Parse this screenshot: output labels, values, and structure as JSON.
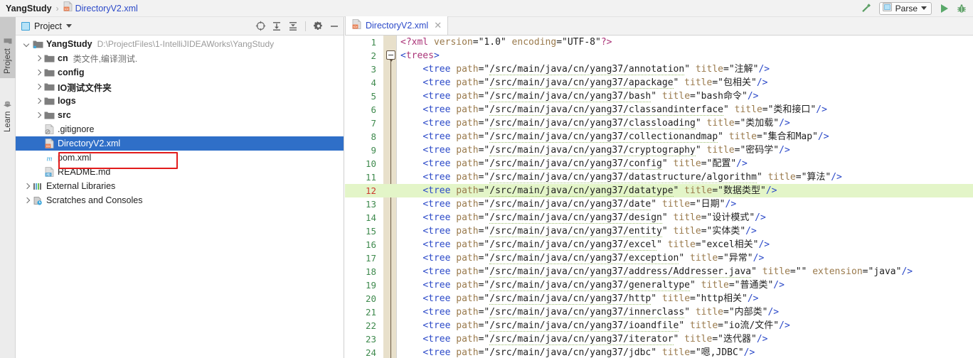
{
  "breadcrumb": {
    "project": "YangStudy",
    "separator": "›",
    "file": "DirectoryV2.xml",
    "file_icon": "xml-file-icon"
  },
  "topbar": {
    "hammer_icon": "build-hammer-icon",
    "run_config_label": "Parse",
    "run_config_icon": "run-configuration-icon",
    "caret_icon": "chevron-down-icon",
    "run_icon": "run-play-icon",
    "debug_icon": "debug-bug-icon",
    "accent_green": "#59a869",
    "accent_blue": "#2b49c8"
  },
  "toolstrip": {
    "items": [
      {
        "label": "Project",
        "icon": "folder-icon",
        "active": true
      },
      {
        "label": "Learn",
        "icon": "graduation-cap-icon",
        "active": false
      }
    ]
  },
  "project_panel": {
    "tab_label": "Project",
    "tab_icon": "project-view-icon",
    "caret_icon": "chevron-down-icon",
    "tools": [
      {
        "name": "select-opened-file-icon",
        "glyph": "⊕"
      },
      {
        "name": "expand-all-icon",
        "glyph": "⤓"
      },
      {
        "name": "collapse-all-icon",
        "glyph": "⤒"
      },
      {
        "name": "settings-gear-icon",
        "glyph": "⚙"
      },
      {
        "name": "hide-panel-icon",
        "glyph": "—"
      }
    ],
    "tree": [
      {
        "indent": 0,
        "arrow": "expanded",
        "icon": "module-folder-icon",
        "label": "YangStudy",
        "bold": true,
        "path": "D:\\ProjectFiles\\1-IntelliJIDEAWorks\\YangStudy",
        "note": "",
        "selected": false
      },
      {
        "indent": 1,
        "arrow": "collapsed",
        "icon": "folder-icon",
        "label": "cn",
        "bold": true,
        "path": "",
        "note": "类文件,编译测试.",
        "selected": false
      },
      {
        "indent": 1,
        "arrow": "collapsed",
        "icon": "folder-icon",
        "label": "config",
        "bold": true,
        "path": "",
        "note": "",
        "selected": false
      },
      {
        "indent": 1,
        "arrow": "collapsed",
        "icon": "folder-icon",
        "label": "IO测试文件夹",
        "bold": true,
        "path": "",
        "note": "",
        "selected": false
      },
      {
        "indent": 1,
        "arrow": "collapsed",
        "icon": "folder-icon",
        "label": "logs",
        "bold": true,
        "path": "",
        "note": "",
        "selected": false
      },
      {
        "indent": 1,
        "arrow": "collapsed",
        "icon": "folder-icon",
        "label": "src",
        "bold": true,
        "path": "",
        "note": "",
        "selected": false
      },
      {
        "indent": 1,
        "arrow": "none",
        "icon": "gitignore-file-icon",
        "label": ".gitignore",
        "bold": false,
        "path": "",
        "note": "",
        "selected": false
      },
      {
        "indent": 1,
        "arrow": "none",
        "icon": "xml-file-icon",
        "label": "DirectoryV2.xml",
        "bold": false,
        "path": "",
        "note": "",
        "selected": true
      },
      {
        "indent": 1,
        "arrow": "none",
        "icon": "maven-file-icon",
        "label": "pom.xml",
        "bold": false,
        "path": "",
        "note": "",
        "selected": false
      },
      {
        "indent": 1,
        "arrow": "none",
        "icon": "markdown-file-icon",
        "label": "README.md",
        "bold": false,
        "path": "",
        "note": "",
        "selected": false
      },
      {
        "indent": 0,
        "arrow": "collapsed",
        "icon": "external-libraries-icon",
        "label": "External Libraries",
        "bold": false,
        "path": "",
        "note": "",
        "selected": false
      },
      {
        "indent": 0,
        "arrow": "collapsed",
        "icon": "scratches-icon",
        "label": "Scratches and Consoles",
        "bold": false,
        "path": "",
        "note": "",
        "selected": false
      }
    ],
    "annotation_box_color": "#e21b1b"
  },
  "editor": {
    "tab": {
      "label": "DirectoryV2.xml",
      "icon": "xml-file-icon",
      "close_icon": "close-icon"
    },
    "highlighted_line": 12,
    "highlight_color": "#e3f5c8",
    "fold_marker_line": 2,
    "lines": [
      {
        "n": 1,
        "type": "pi",
        "text": "<?xml version=\"1.0\" encoding=\"UTF-8\"?>"
      },
      {
        "n": 2,
        "type": "root",
        "text": "<trees>"
      },
      {
        "n": 3,
        "type": "tree",
        "path": "/src/main/java/cn/yang37/annotation",
        "title": "注解",
        "extension": ""
      },
      {
        "n": 4,
        "type": "tree",
        "path": "/src/main/java/cn/yang37/apackage",
        "title": "包相关",
        "extension": ""
      },
      {
        "n": 5,
        "type": "tree",
        "path": "/src/main/java/cn/yang37/bash",
        "title": "bash命令",
        "extension": ""
      },
      {
        "n": 6,
        "type": "tree",
        "path": "/src/main/java/cn/yang37/classandinterface",
        "title": "类和接口",
        "extension": ""
      },
      {
        "n": 7,
        "type": "tree",
        "path": "/src/main/java/cn/yang37/classloading",
        "title": "类加载",
        "extension": ""
      },
      {
        "n": 8,
        "type": "tree",
        "path": "/src/main/java/cn/yang37/collectionandmap",
        "title": "集合和Map",
        "extension": ""
      },
      {
        "n": 9,
        "type": "tree",
        "path": "/src/main/java/cn/yang37/cryptography",
        "title": "密码学",
        "extension": ""
      },
      {
        "n": 10,
        "type": "tree",
        "path": "/src/main/java/cn/yang37/config",
        "title": "配置",
        "extension": ""
      },
      {
        "n": 11,
        "type": "tree",
        "path": "/src/main/java/cn/yang37/datastructure/algorithm",
        "title": "算法",
        "extension": ""
      },
      {
        "n": 12,
        "type": "tree",
        "path": "/src/main/java/cn/yang37/datatype",
        "title": "数据类型",
        "extension": ""
      },
      {
        "n": 13,
        "type": "tree",
        "path": "/src/main/java/cn/yang37/date",
        "title": "日期",
        "extension": ""
      },
      {
        "n": 14,
        "type": "tree",
        "path": "/src/main/java/cn/yang37/design",
        "title": "设计模式",
        "extension": ""
      },
      {
        "n": 15,
        "type": "tree",
        "path": "/src/main/java/cn/yang37/entity",
        "title": "实体类",
        "extension": ""
      },
      {
        "n": 16,
        "type": "tree",
        "path": "/src/main/java/cn/yang37/excel",
        "title": "excel相关",
        "extension": ""
      },
      {
        "n": 17,
        "type": "tree",
        "path": "/src/main/java/cn/yang37/exception",
        "title": "异常",
        "extension": ""
      },
      {
        "n": 18,
        "type": "tree",
        "path": "/src/main/java/cn/yang37/address/Addresser.java",
        "title": "",
        "extension": "java"
      },
      {
        "n": 19,
        "type": "tree",
        "path": "/src/main/java/cn/yang37/generaltype",
        "title": "普通类",
        "extension": ""
      },
      {
        "n": 20,
        "type": "tree",
        "path": "/src/main/java/cn/yang37/http",
        "title": "http相关",
        "extension": ""
      },
      {
        "n": 21,
        "type": "tree",
        "path": "/src/main/java/cn/yang37/innerclass",
        "title": "内部类",
        "extension": ""
      },
      {
        "n": 22,
        "type": "tree",
        "path": "/src/main/java/cn/yang37/ioandfile",
        "title": "io流/文件",
        "extension": ""
      },
      {
        "n": 23,
        "type": "tree",
        "path": "/src/main/java/cn/yang37/iterator",
        "title": "迭代器",
        "extension": ""
      },
      {
        "n": 24,
        "type": "tree",
        "path": "/src/main/java/cn/yang37/jdbc",
        "title": "嗯,JDBC",
        "extension": ""
      }
    ],
    "tag_name": "tree",
    "attr_path": "path",
    "attr_title": "title",
    "attr_extension": "extension"
  }
}
